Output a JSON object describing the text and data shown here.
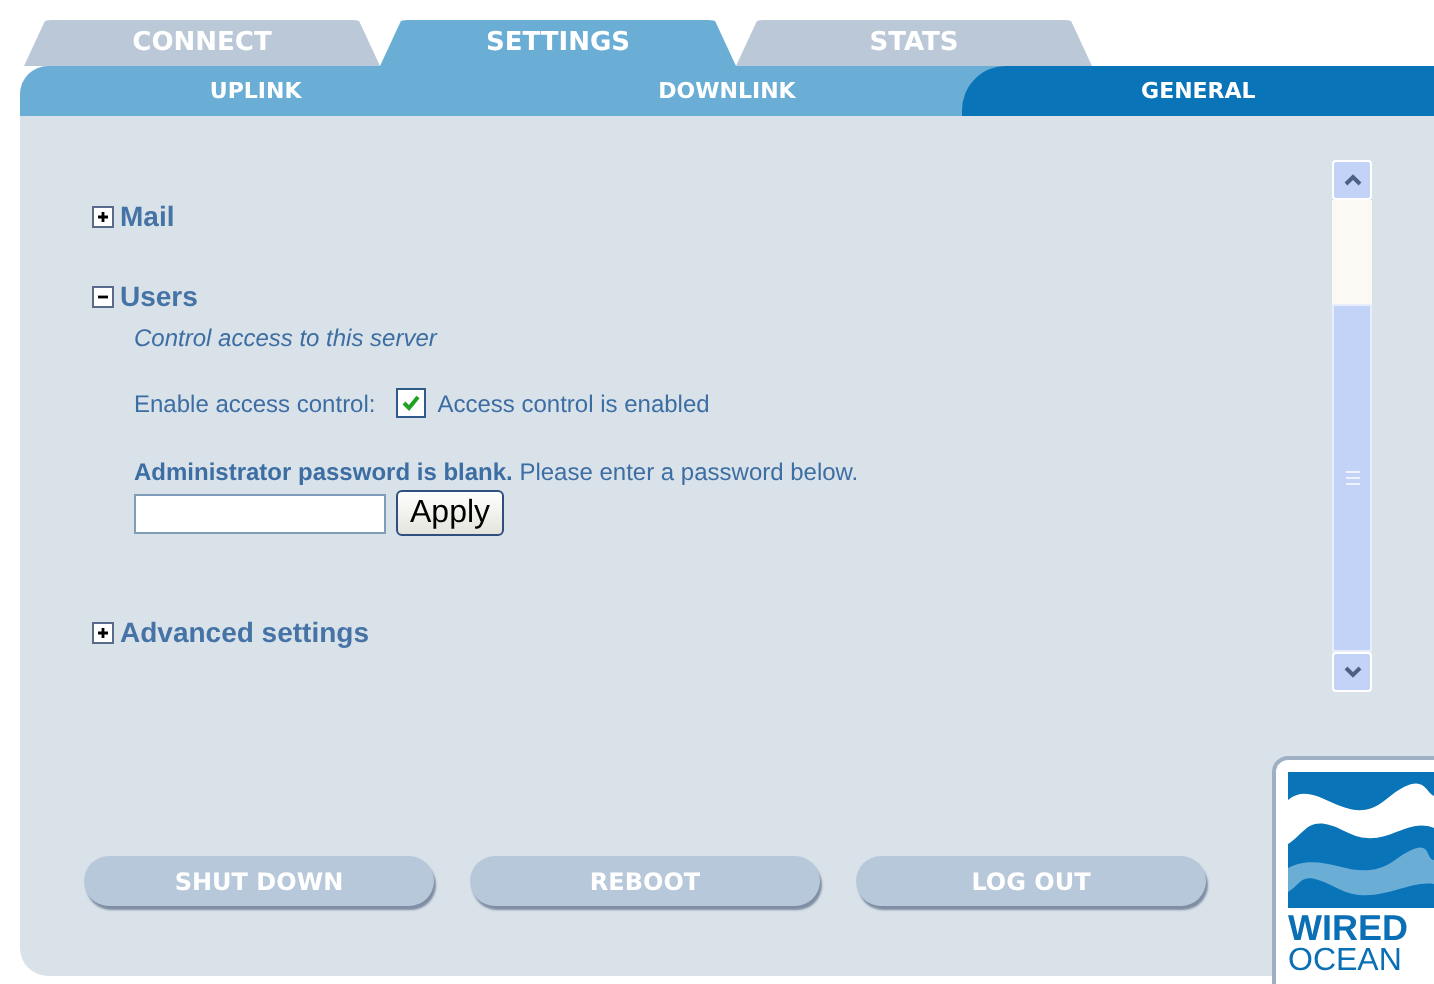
{
  "tabs": [
    {
      "label": "CONNECT",
      "selected": false
    },
    {
      "label": "SETTINGS",
      "selected": true
    },
    {
      "label": "STATS",
      "selected": false
    }
  ],
  "subtabs": [
    {
      "label": "UPLINK",
      "selected": false
    },
    {
      "label": "DOWNLINK",
      "selected": false
    },
    {
      "label": "GENERAL",
      "selected": true
    }
  ],
  "sections": [
    {
      "title": "Mail",
      "expanded": false
    },
    {
      "title": "Users",
      "expanded": true,
      "description": "Control access to this server",
      "access_control": {
        "label": "Enable access control:",
        "checked": true,
        "text": "Access control is enabled"
      },
      "password_notice": "**Administrator password is blank.** Please enter a password below.",
      "apply_button": "Apply"
    },
    {
      "title": "Advanced settings",
      "expanded": false
    }
  ],
  "buttons": [
    "SHUT DOWN",
    "REBOOT",
    "LOG OUT"
  ],
  "logo": {
    "line_1": "WIRED",
    "line_2": "OCEAN"
  }
}
